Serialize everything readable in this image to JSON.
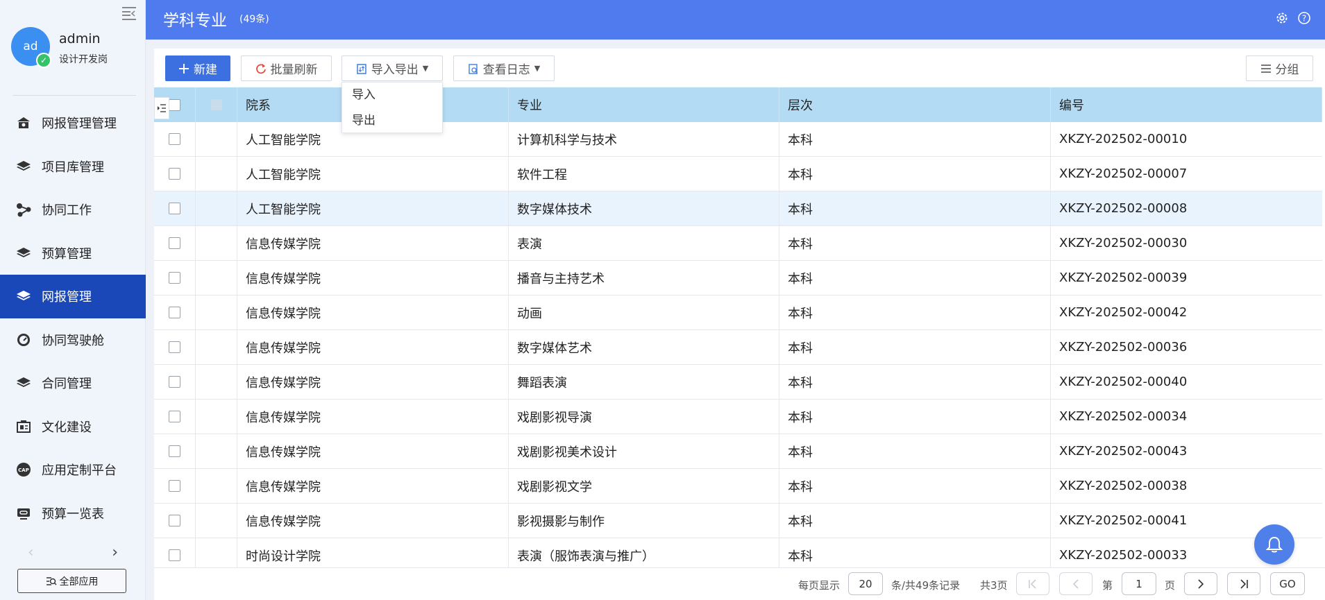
{
  "user": {
    "avatar_text": "ad",
    "name": "admin",
    "role": "设计开发岗"
  },
  "sidebar": {
    "items": [
      {
        "label": "网报管理管理",
        "icon": "bank-icon"
      },
      {
        "label": "项目库管理",
        "icon": "layers-icon"
      },
      {
        "label": "协同工作",
        "icon": "share-icon"
      },
      {
        "label": "预算管理",
        "icon": "layers-icon"
      },
      {
        "label": "网报管理",
        "icon": "layers-icon",
        "active": true
      },
      {
        "label": "协同驾驶舱",
        "icon": "speedometer-icon"
      },
      {
        "label": "合同管理",
        "icon": "layers-icon"
      },
      {
        "label": "文化建设",
        "icon": "id-card-icon"
      },
      {
        "label": "应用定制平台",
        "icon": "cap-icon"
      },
      {
        "label": "预算一览表",
        "icon": "link-icon"
      }
    ],
    "all_apps": "全部应用"
  },
  "header": {
    "title": "学科专业",
    "count": "(49条)"
  },
  "toolbar": {
    "new": "新建",
    "refresh": "批量刷新",
    "import_export": "导入导出",
    "view_log": "查看日志",
    "group": "分组"
  },
  "dropdown": {
    "items": [
      "导入",
      "导出"
    ]
  },
  "table": {
    "columns": [
      "院系",
      "专业",
      "层次",
      "编号"
    ],
    "rows": [
      [
        "人工智能学院",
        "计算机科学与技术",
        "本科",
        "XKZY-202502-00010"
      ],
      [
        "人工智能学院",
        "软件工程",
        "本科",
        "XKZY-202502-00007"
      ],
      [
        "人工智能学院",
        "数字媒体技术",
        "本科",
        "XKZY-202502-00008"
      ],
      [
        "信息传媒学院",
        "表演",
        "本科",
        "XKZY-202502-00030"
      ],
      [
        "信息传媒学院",
        "播音与主持艺术",
        "本科",
        "XKZY-202502-00039"
      ],
      [
        "信息传媒学院",
        "动画",
        "本科",
        "XKZY-202502-00042"
      ],
      [
        "信息传媒学院",
        "数字媒体艺术",
        "本科",
        "XKZY-202502-00036"
      ],
      [
        "信息传媒学院",
        "舞蹈表演",
        "本科",
        "XKZY-202502-00040"
      ],
      [
        "信息传媒学院",
        "戏剧影视导演",
        "本科",
        "XKZY-202502-00034"
      ],
      [
        "信息传媒学院",
        "戏剧影视美术设计",
        "本科",
        "XKZY-202502-00043"
      ],
      [
        "信息传媒学院",
        "戏剧影视文学",
        "本科",
        "XKZY-202502-00038"
      ],
      [
        "信息传媒学院",
        "影视摄影与制作",
        "本科",
        "XKZY-202502-00041"
      ],
      [
        "时尚设计学院",
        "表演（服饰表演与推广）",
        "本科",
        "XKZY-202502-00033"
      ]
    ]
  },
  "pager": {
    "per_page_label": "每页显示",
    "per_page": "20",
    "total_label": "条/共49条记录",
    "pages_label": "共3页",
    "page_prefix": "第",
    "page": "1",
    "page_suffix": "页",
    "go": "GO"
  },
  "colors": {
    "header": "#4f7bee",
    "active_nav": "#1a48b8",
    "primary_button": "#3c6fe0",
    "table_header": "#b4dbf4"
  }
}
